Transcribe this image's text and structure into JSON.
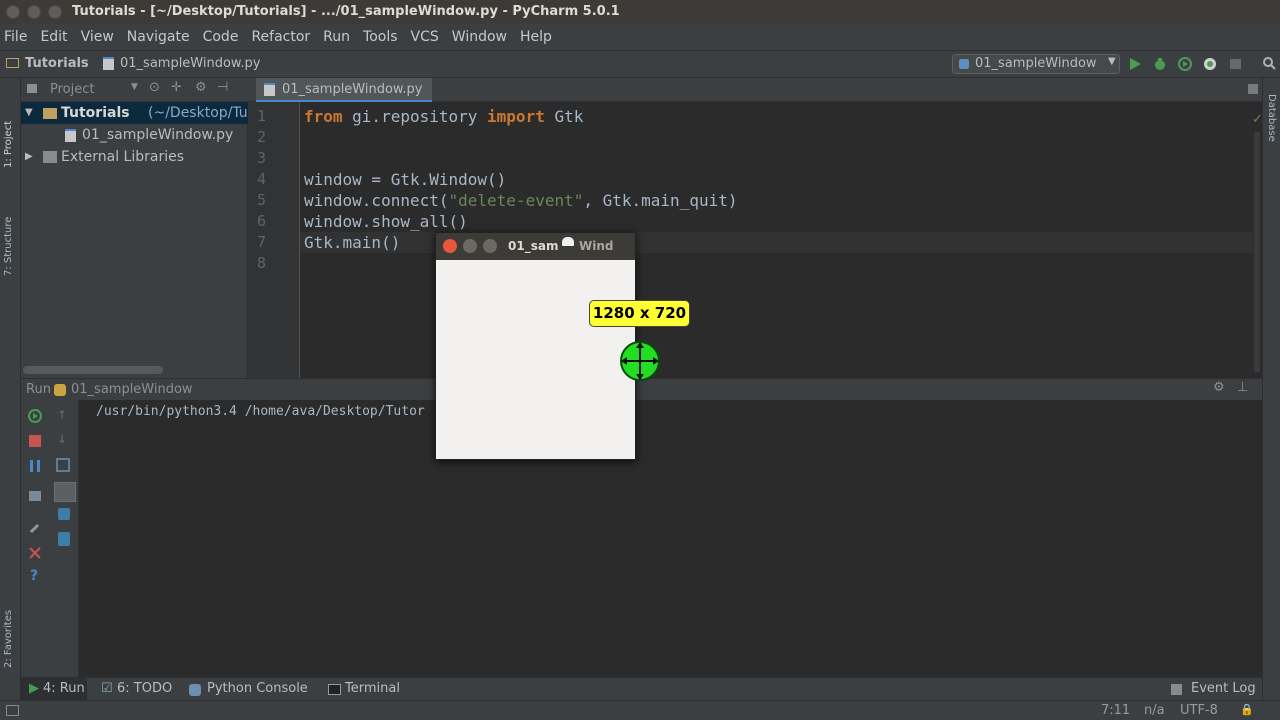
{
  "title": "Tutorials - [~/Desktop/Tutorials] - .../01_sampleWindow.py - PyCharm 5.0.1",
  "menu": [
    "File",
    "Edit",
    "View",
    "Navigate",
    "Code",
    "Refactor",
    "Run",
    "Tools",
    "VCS",
    "Window",
    "Help"
  ],
  "nav": {
    "crumb1": "Tutorials",
    "crumb2": "01_sampleWindow.py",
    "run_config": "01_sampleWindow"
  },
  "left_strip": {
    "project": "1: Project",
    "structure": "7: Structure",
    "favorites": "2: Favorites"
  },
  "right_strip": {
    "database": "Database"
  },
  "project_panel": {
    "header": "Project",
    "root_name": "Tutorials",
    "root_path": "(~/Desktop/Tutor",
    "file": "01_sampleWindow.py",
    "external": "External Libraries"
  },
  "editor": {
    "tab": "01_sampleWindow.py",
    "line_numbers": [
      "1",
      "2",
      "3",
      "4",
      "5",
      "6",
      "7",
      "8"
    ],
    "lines": [
      [
        {
          "t": "from",
          "c": "kw"
        },
        {
          "t": " gi.repository ",
          "c": ""
        },
        {
          "t": "import",
          "c": "kw"
        },
        {
          "t": " Gtk",
          "c": ""
        }
      ],
      [],
      [],
      [
        {
          "t": "window = Gtk.Window()",
          "c": ""
        }
      ],
      [
        {
          "t": "window.connect(",
          "c": ""
        },
        {
          "t": "\"delete-event\"",
          "c": "st"
        },
        {
          "t": ", Gtk.main_quit)",
          "c": ""
        }
      ],
      [
        {
          "t": "window.show_all()",
          "c": ""
        }
      ],
      [
        {
          "t": "Gtk.main()",
          "c": ""
        }
      ],
      []
    ]
  },
  "run": {
    "label": "Run",
    "config": "01_sampleWindow",
    "console": "/usr/bin/python3.4 /home/ava/Desktop/Tutor"
  },
  "bottom_tabs": {
    "run": "4: Run",
    "todo": "6: TODO",
    "console": "Python Console",
    "terminal": "Terminal",
    "event_log": "Event Log"
  },
  "status": {
    "position": "7:11",
    "na": "n/a",
    "encoding": "UTF-8"
  },
  "gtk_window": {
    "title": "01_sam",
    "title_rest": "Wind"
  },
  "overlay": {
    "dimensions": "1280 x 720"
  },
  "colors": {
    "keyword": "#cc7832",
    "string": "#6a8759",
    "run_green": "#499c54",
    "stop_red": "#c75450",
    "badge_yellow": "#ffff33",
    "crosshair_green": "#22dd22"
  }
}
